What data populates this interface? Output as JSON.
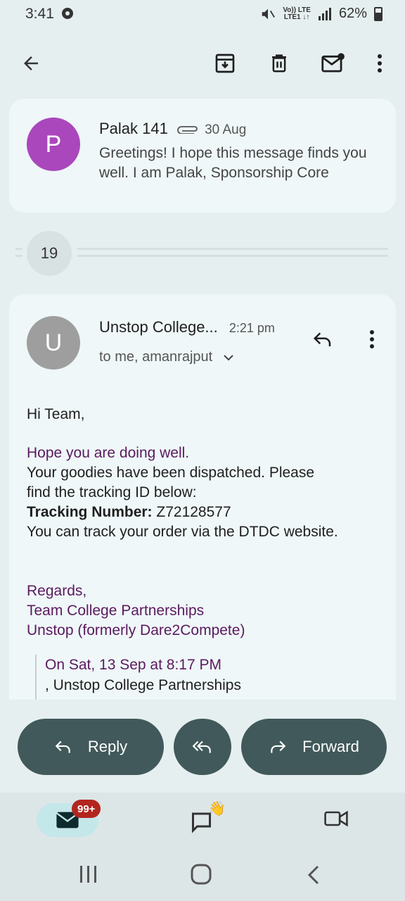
{
  "status": {
    "time": "3:41",
    "network_top": "Vo)) LTE",
    "network_bottom": "LTE1 ↓↑",
    "battery": "62%"
  },
  "toolbar": {
    "back": "back-arrow-icon",
    "archive": "archive-icon",
    "delete": "trash-icon",
    "mark_unread": "mark-unread-icon",
    "more": "more-vert-icon"
  },
  "collapsed_message": {
    "avatar_letter": "P",
    "avatar_color": "#aa47bc",
    "sender": "Palak 141",
    "date": "30 Aug",
    "snippet": "Greetings! I hope this message finds you well. I am Palak, Sponsorship Core"
  },
  "hidden_messages": {
    "count": "19"
  },
  "open_message": {
    "avatar_letter": "U",
    "avatar_color": "#9e9e9e",
    "sender": "Unstop College...",
    "time": "2:21 pm",
    "recipients": "to me, amanrajput",
    "greeting": "Hi Team,",
    "line1": "Hope you are doing well.",
    "line2": "Your goodies have been dispatched. Please",
    "line3": "find the tracking ID below:",
    "tracking_label": "Tracking Number:",
    "tracking_value": "Z72128577",
    "line4": "You can track your order via the DTDC website.",
    "regards": "Regards,",
    "team": "Team College Partnerships",
    "company": "Unstop (formerly Dare2Compete)",
    "quote_header": "On Sat, 13 Sep at 8:17 PM",
    "quote_line": ", Unstop College Partnerships"
  },
  "actions": {
    "reply": "Reply",
    "forward": "Forward"
  },
  "bottom_nav": {
    "mail_badge": "99+"
  }
}
